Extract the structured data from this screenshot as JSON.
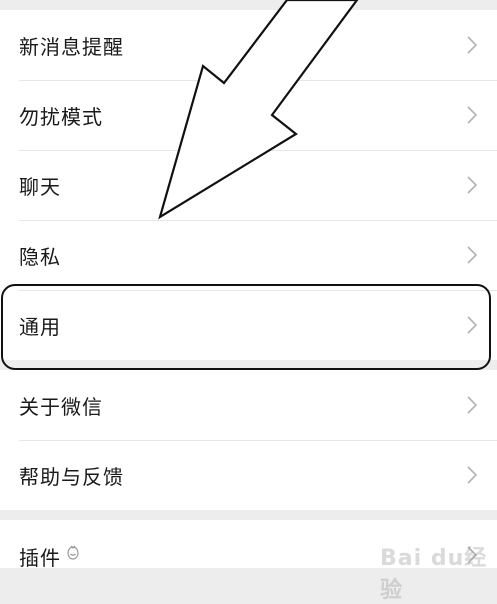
{
  "settings": {
    "items": [
      {
        "label": "新消息提醒"
      },
      {
        "label": "勿扰模式"
      },
      {
        "label": "聊天"
      },
      {
        "label": "隐私"
      },
      {
        "label": "通用"
      },
      {
        "label": "关于微信"
      },
      {
        "label": "帮助与反馈"
      },
      {
        "label": "插件"
      }
    ]
  },
  "watermark": {
    "text": "Bai du经验"
  },
  "icons": {
    "chevron": "chevron-right-icon",
    "plugin": "plugin-badge-icon",
    "arrow": "annotation-arrow",
    "highlight": "annotation-box"
  },
  "colors": {
    "background": "#ededed",
    "card": "#ffffff",
    "text": "#1a1a1a",
    "chevron": "#b2b2b2",
    "annotation": "#111111"
  }
}
